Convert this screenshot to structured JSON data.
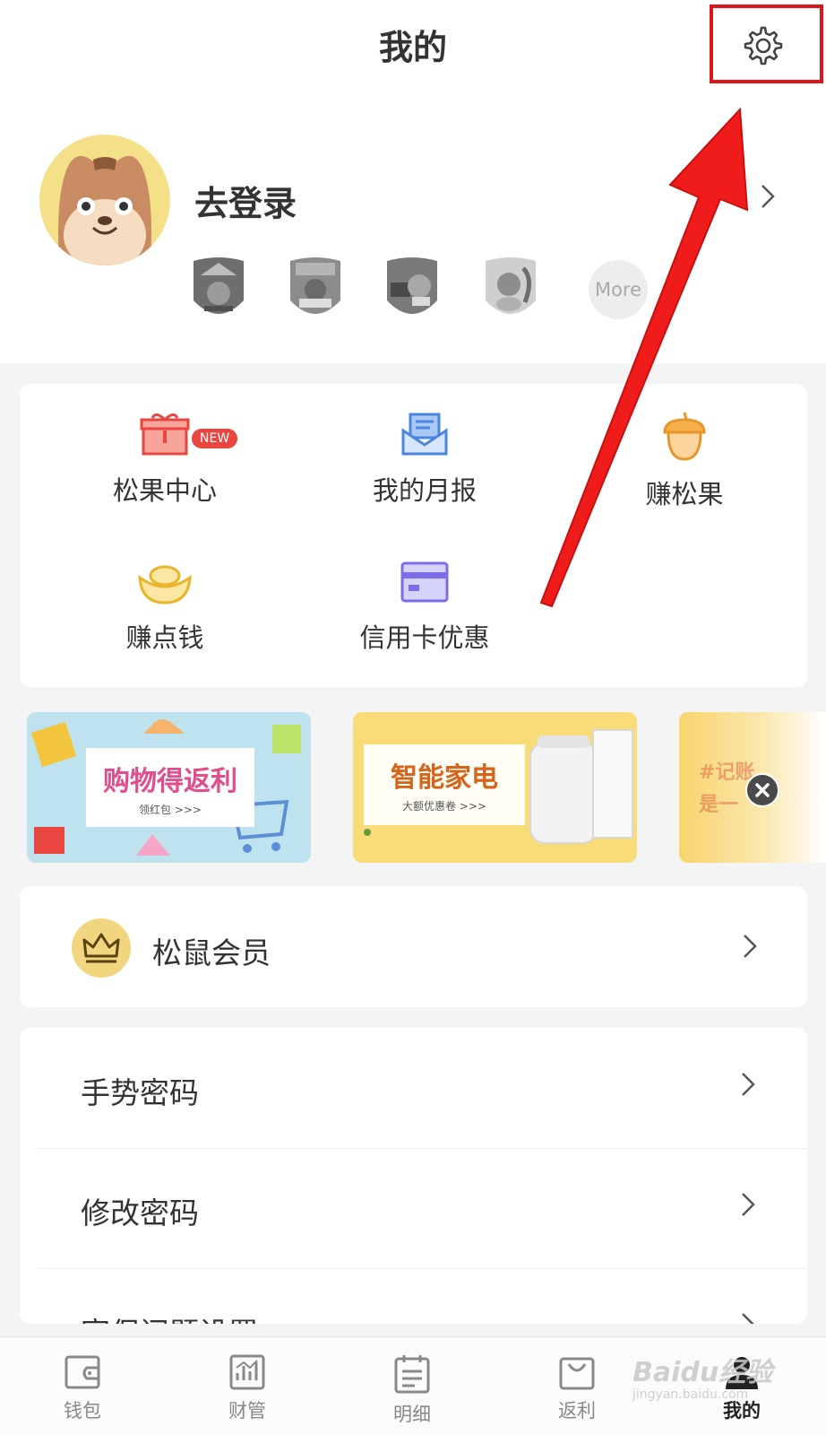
{
  "header": {
    "title": "我的"
  },
  "profile": {
    "login_label": "去登录",
    "badges_more_label": "More"
  },
  "grid": {
    "items": [
      {
        "label": "松果中心",
        "icon": "gift-icon",
        "badge": "NEW"
      },
      {
        "label": "我的月报",
        "icon": "mail-report-icon"
      },
      {
        "label": "赚松果",
        "icon": "acorn-icon"
      },
      {
        "label": "赚点钱",
        "icon": "gold-ingot-icon"
      },
      {
        "label": "信用卡优惠",
        "icon": "credit-card-icon"
      }
    ]
  },
  "banners": [
    {
      "title": "购物得返利",
      "subtitle": "领红包 >>>"
    },
    {
      "title": "智能家电",
      "subtitle": "大额优惠卷 >>>"
    },
    {
      "title": "#记账",
      "subtitle": "是一"
    }
  ],
  "vip": {
    "label": "松鼠会员"
  },
  "menu": {
    "items": [
      {
        "label": "手势密码"
      },
      {
        "label": "修改密码"
      },
      {
        "label": "密保问题设置"
      }
    ]
  },
  "tabbar": {
    "items": [
      {
        "label": "钱包",
        "icon": "wallet-icon"
      },
      {
        "label": "财管",
        "icon": "chart-icon"
      },
      {
        "label": "明细",
        "icon": "list-icon"
      },
      {
        "label": "返利",
        "icon": "bag-icon"
      },
      {
        "label": "我的",
        "icon": "user-icon",
        "active": true
      }
    ]
  },
  "watermark": {
    "main": "Baidu经验",
    "sub": "jingyan.baidu.com"
  },
  "colors": {
    "accent_red": "#e0141b",
    "avatar_bg": "#f5e08a",
    "new_badge": "#e8463f",
    "page_bg": "#f4f4f4"
  }
}
